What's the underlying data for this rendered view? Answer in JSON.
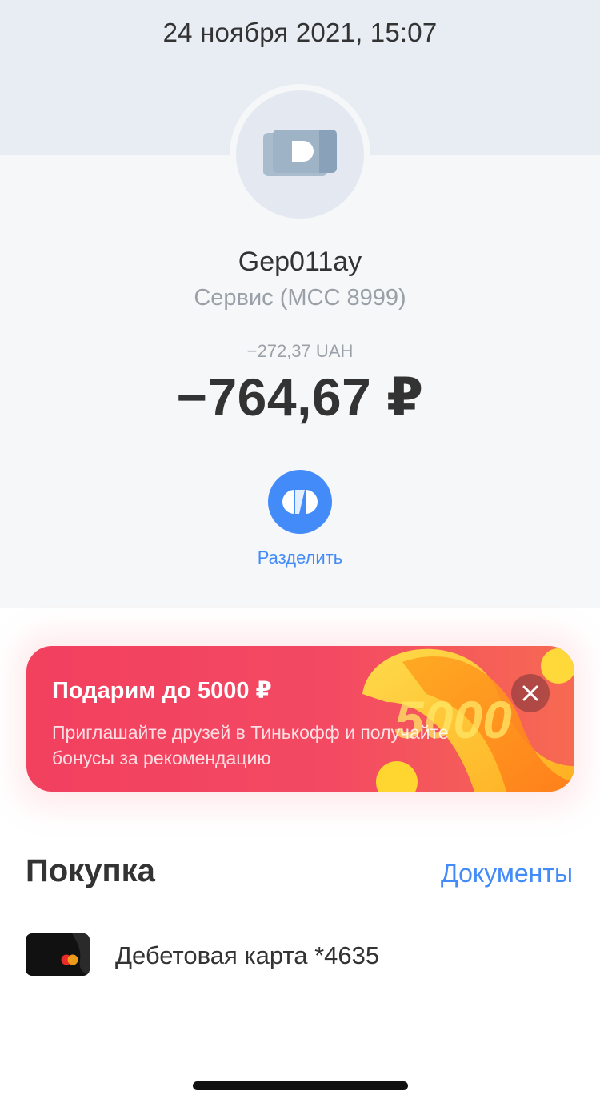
{
  "header": {
    "datetime": "24 ноября 2021, 15:07"
  },
  "merchant": {
    "icon": "cash-icon",
    "name": "Gep011ay",
    "category": "Сервис (MCC 8999)"
  },
  "amount": {
    "foreign": "−272,37 UAH",
    "main": "−764,67 ₽"
  },
  "actions": {
    "split_label": "Разделить",
    "split_icon": "split-icon"
  },
  "promo": {
    "title": "Подарим до 5000 ₽",
    "text": "Приглашайте друзей в Тинькофф и получайте бонусы за рекомендацию",
    "art_number": "5000",
    "close_icon": "close-icon"
  },
  "purchase": {
    "section_title": "Покупка",
    "documents_link": "Документы",
    "card_label": "Дебетовая карта *4635",
    "card_icon": "mastercard-icon"
  },
  "colors": {
    "accent_blue": "#428bf9",
    "promo_red": "#f2405f",
    "text_dark": "#333333",
    "text_muted": "#9aa0a8"
  }
}
